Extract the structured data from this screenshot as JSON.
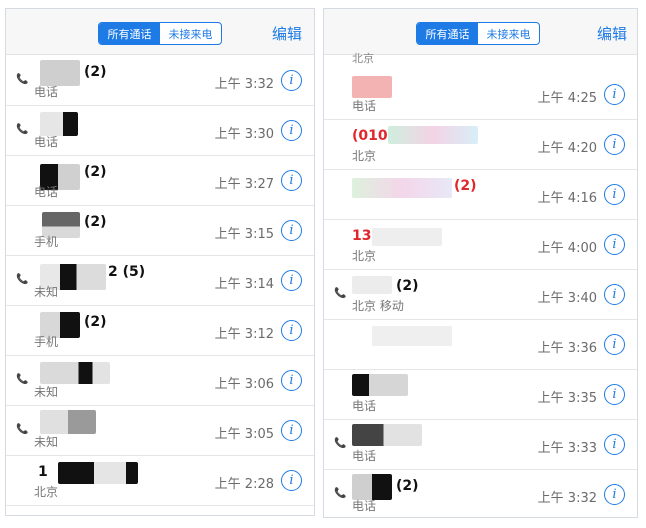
{
  "segment": {
    "all": "所有通话",
    "missed": "未接来电"
  },
  "edit": "编辑",
  "left_rows": [
    {
      "name": "(2)",
      "sub": "电话",
      "time": "上午 3:32"
    },
    {
      "name": "",
      "sub": "电话",
      "time": "上午 3:30"
    },
    {
      "name": "(2)",
      "sub": "电话",
      "time": "上午 3:27"
    },
    {
      "name": "(2)",
      "sub": "手机",
      "time": "上午 3:15"
    },
    {
      "name": "2 (5)",
      "sub": "未知",
      "time": "上午 3:14"
    },
    {
      "name": "(2)",
      "sub": "手机",
      "time": "上午 3:12"
    },
    {
      "name": "",
      "sub": "未知",
      "time": "上午 3:06"
    },
    {
      "name": "",
      "sub": "未知",
      "time": "上午 3:05"
    },
    {
      "name": "1",
      "sub": "北京",
      "time": "上午 2:28"
    }
  ],
  "right_top_fragment": "北京",
  "right_rows": [
    {
      "name": "",
      "sub": "电话",
      "time": "上午 4:25"
    },
    {
      "name": "(010",
      "sub": "北京",
      "time": "上午 4:20"
    },
    {
      "name": "(2)",
      "sub": "",
      "time": "上午 4:16"
    },
    {
      "name": "13",
      "sub": "北京",
      "time": "上午 4:00"
    },
    {
      "name": "(2)",
      "sub": "北京 移动",
      "time": "上午 3:40"
    },
    {
      "name": "",
      "sub": "",
      "time": "上午 3:36"
    },
    {
      "name": "",
      "sub": "电话",
      "time": "上午 3:35"
    },
    {
      "name": "",
      "sub": "电话",
      "time": "上午 3:33"
    },
    {
      "name": "(2)",
      "sub": "电话",
      "time": "上午 3:32"
    }
  ],
  "info_glyph": "i",
  "colors": {
    "accent": "#1e7be6",
    "missed": "#e0272b"
  }
}
